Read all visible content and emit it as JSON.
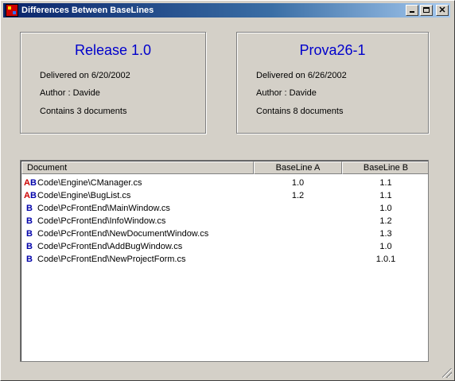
{
  "window": {
    "title": "Differences Between BaseLines"
  },
  "left_panel": {
    "title": "Release 1.0",
    "delivered": "Delivered on 6/20/2002",
    "author": "Author : Davide",
    "contains": "Contains 3 documents"
  },
  "right_panel": {
    "title": "Prova26-1",
    "delivered": "Delivered on 6/26/2002",
    "author": "Author : Davide",
    "contains": "Contains 8 documents"
  },
  "table": {
    "columns": [
      "Document",
      "BaseLine A",
      "BaseLine B"
    ],
    "rows": [
      {
        "icon": "AB",
        "document": "Code\\Engine\\CManager.cs",
        "baseline_a": "1.0",
        "baseline_b": "1.1"
      },
      {
        "icon": "AB",
        "document": "Code\\Engine\\BugList.cs",
        "baseline_a": "1.2",
        "baseline_b": "1.1"
      },
      {
        "icon": "B",
        "document": "Code\\PcFrontEnd\\MainWindow.cs",
        "baseline_a": "",
        "baseline_b": "1.0"
      },
      {
        "icon": "B",
        "document": "Code\\PcFrontEnd\\InfoWindow.cs",
        "baseline_a": "",
        "baseline_b": "1.2"
      },
      {
        "icon": "B",
        "document": "Code\\PcFrontEnd\\NewDocumentWindow.cs",
        "baseline_a": "",
        "baseline_b": "1.3"
      },
      {
        "icon": "B",
        "document": "Code\\PcFrontEnd\\AddBugWindow.cs",
        "baseline_a": "",
        "baseline_b": "1.0"
      },
      {
        "icon": "B",
        "document": "Code\\PcFrontEnd\\NewProjectForm.cs",
        "baseline_a": "",
        "baseline_b": "1.0.1"
      }
    ]
  },
  "colors": {
    "title_accent": "#0000cc",
    "icon_a": "#cc0000",
    "icon_b": "#0000aa",
    "titlebar": "#0a246a"
  }
}
